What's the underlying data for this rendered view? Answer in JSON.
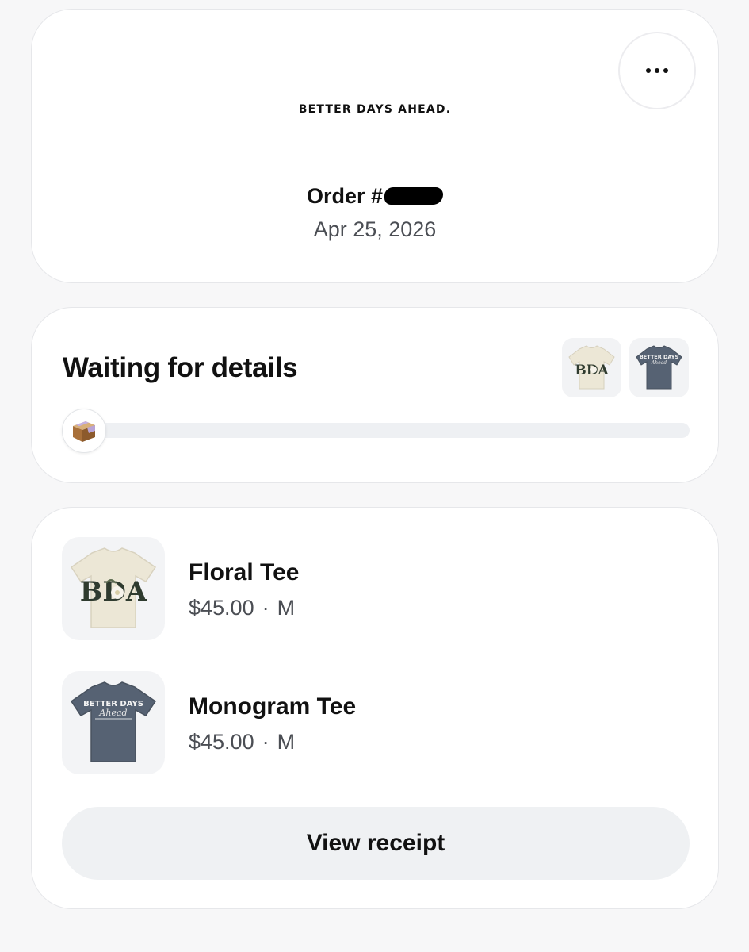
{
  "header": {
    "brand": "BETTER DAYS AHEAD.",
    "order_label": "Order #",
    "order_date": "Apr 25, 2026",
    "more_icon": "more-horizontal-icon"
  },
  "status": {
    "title": "Waiting for details",
    "progress_fraction": 0.04,
    "badge_icon": "package-box-icon"
  },
  "items": [
    {
      "name": "Floral Tee",
      "price": "$45.00",
      "separator": "·",
      "size": "M",
      "shirt_color": "#ece7d6",
      "print_text": "BDA"
    },
    {
      "name": "Monogram Tee",
      "price": "$45.00",
      "separator": "·",
      "size": "M",
      "shirt_color": "#566273",
      "print_text": "BETTER DAYS"
    }
  ],
  "actions": {
    "view_receipt_label": "View receipt"
  },
  "colors": {
    "background": "#f7f7f8",
    "card": "#ffffff",
    "button_bg": "#eff1f3",
    "progress_track": "#eef0f3"
  }
}
